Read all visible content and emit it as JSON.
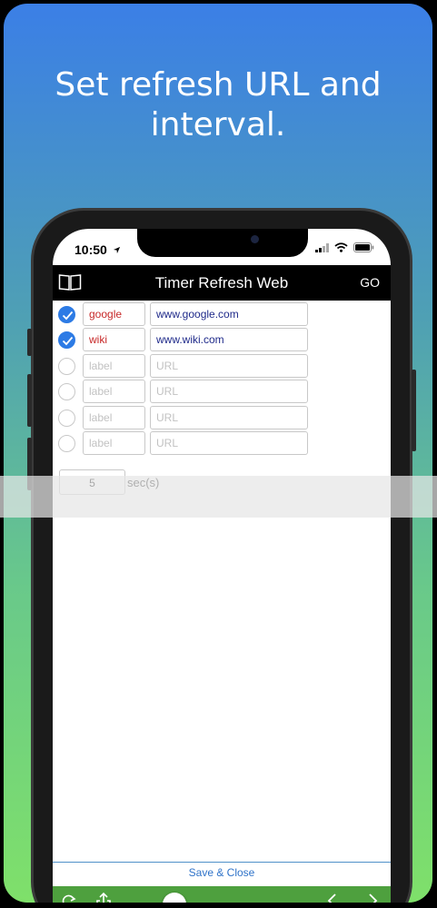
{
  "headline": {
    "line1": "Set refresh URL and",
    "line2": "interval."
  },
  "status": {
    "time": "10:50"
  },
  "nav": {
    "title": "Timer Refresh Web",
    "go": "GO"
  },
  "rows": [
    {
      "checked": true,
      "label": "google",
      "url": "www.google.com",
      "label_placeholder": "label",
      "url_placeholder": "URL"
    },
    {
      "checked": true,
      "label": "wiki",
      "url": "www.wiki.com",
      "label_placeholder": "label",
      "url_placeholder": "URL"
    },
    {
      "checked": false,
      "label": "",
      "url": "",
      "label_placeholder": "label",
      "url_placeholder": "URL"
    },
    {
      "checked": false,
      "label": "",
      "url": "",
      "label_placeholder": "label",
      "url_placeholder": "URL"
    },
    {
      "checked": false,
      "label": "",
      "url": "",
      "label_placeholder": "label",
      "url_placeholder": "URL"
    },
    {
      "checked": false,
      "label": "",
      "url": "",
      "label_placeholder": "label",
      "url_placeholder": "URL"
    }
  ],
  "interval": {
    "value": "5",
    "unit": "sec(s)"
  },
  "footer": {
    "save_close": "Save & Close"
  },
  "colors": {
    "check_on": "#2d7be5",
    "label_text": "#c72828",
    "url_text": "#1f2a8a",
    "toolbar": "#4ea03e",
    "navbar": "#000000"
  },
  "icons": {
    "book": "book-icon",
    "refresh": "refresh-icon",
    "share": "share-icon",
    "back": "chevron-left-icon",
    "forward": "chevron-right-icon"
  }
}
